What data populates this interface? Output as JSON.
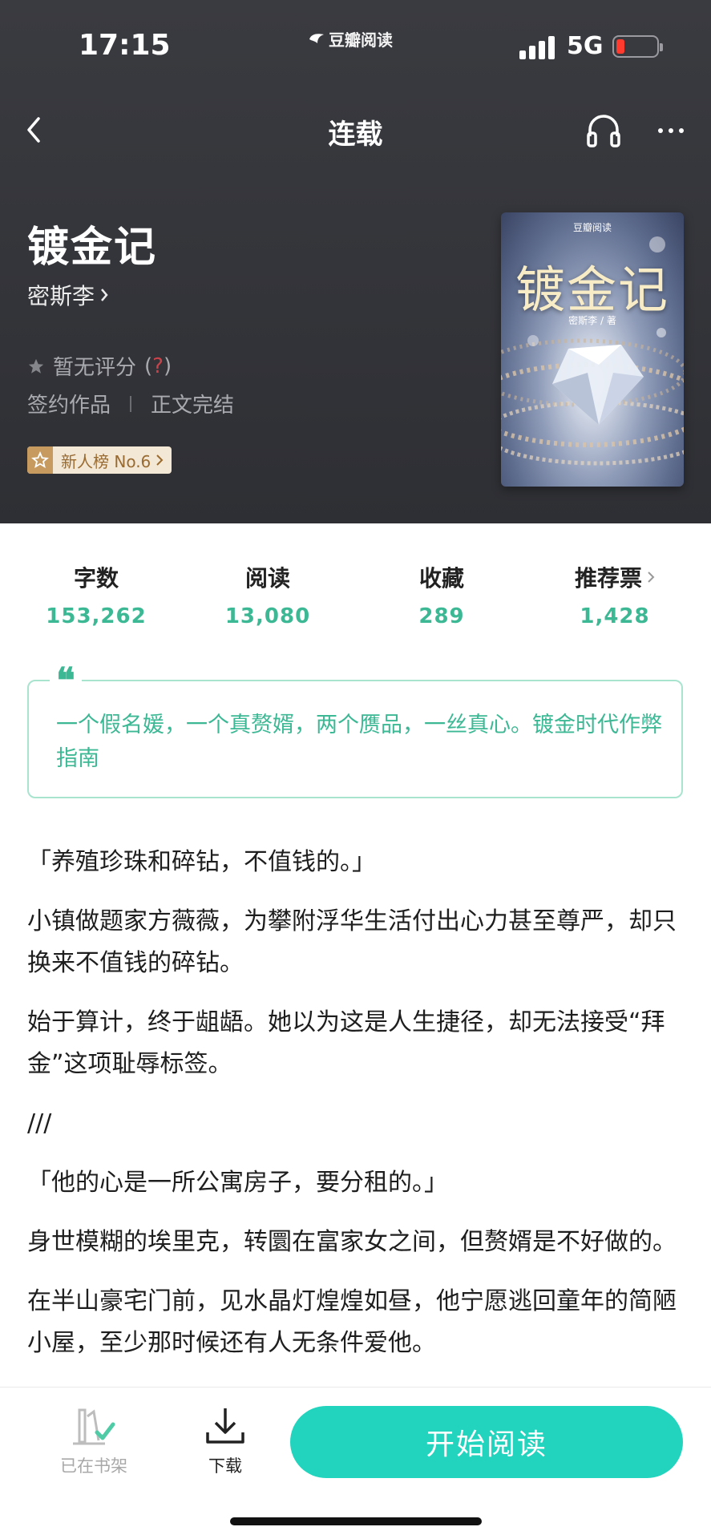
{
  "status_bar": {
    "time": "17:15",
    "app_name": "豆瓣阅读",
    "network": "5G"
  },
  "nav": {
    "title": "连载"
  },
  "book": {
    "title": "镀金记",
    "author": "密斯李",
    "rating": "暂无评分",
    "rating_help": "?",
    "tag_signed": "签约作品",
    "tag_status": "正文完结",
    "rank_badge": "新人榜 No.6"
  },
  "cover": {
    "brand": "豆瓣阅读",
    "title": "镀金记",
    "author": "密斯李 / 著"
  },
  "stats": [
    {
      "label": "字数",
      "value": "153,262"
    },
    {
      "label": "阅读",
      "value": "13,080"
    },
    {
      "label": "收藏",
      "value": "289"
    },
    {
      "label": "推荐票",
      "value": "1,428"
    }
  ],
  "quote": {
    "text": "一个假名媛，一个真赘婿，两个赝品，一丝真心。镀金时代作弊指南"
  },
  "intro": [
    "「养殖珍珠和碎钻，不值钱的。」",
    "小镇做题家方薇薇，为攀附浮华生活付出心力甚至尊严，却只换来不值钱的碎钻。",
    "始于算计，终于龃龉。她以为这是人生捷径，却无法接受“拜金”这项耻辱标签。",
    "///",
    "「他的心是一所公寓房子，要分租的。」",
    "身世模糊的埃里克，转圜在富家女之间，但赘婿是不好做的。",
    "在半山豪宅门前，见水晶灯煌煌如昼，他宁愿逃回童年的简陋小屋，至少那时候还有人无条件爱他。"
  ],
  "bottom": {
    "shelf_label": "已在书架",
    "download_label": "下载",
    "read_button": "开始阅读"
  },
  "colors": {
    "accent": "#3db894",
    "button": "#22d4bd",
    "header_bg": "#35363b"
  }
}
